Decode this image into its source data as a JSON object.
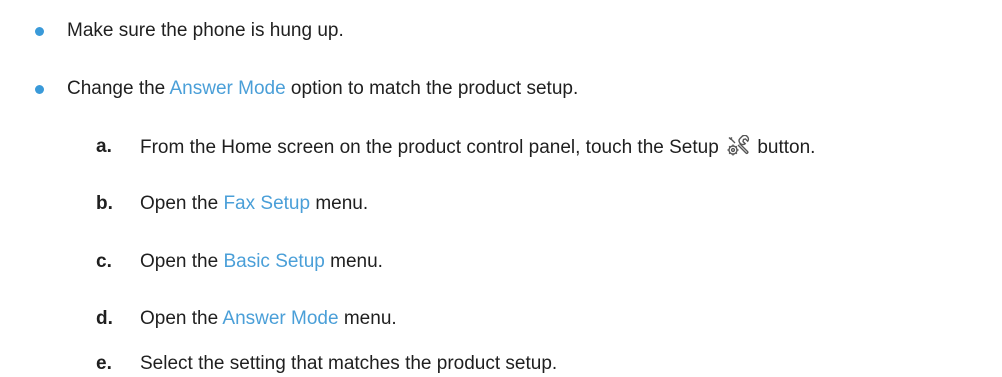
{
  "bullets": [
    {
      "text": "Make sure the phone is hung up."
    },
    {
      "pre": "Change the ",
      "kw": "Answer Mode",
      "post": " option to match the product setup."
    }
  ],
  "steps": [
    {
      "marker": "a.",
      "pre": "From the Home screen on the product control panel, touch the Setup ",
      "post": " button."
    },
    {
      "marker": "b.",
      "pre": "Open the ",
      "kw": "Fax Setup",
      "post": " menu."
    },
    {
      "marker": "c.",
      "pre": "Open the ",
      "kw": "Basic Setup",
      "post": " menu."
    },
    {
      "marker": "d.",
      "pre": "Open the ",
      "kw": "Answer Mode",
      "post": " menu."
    },
    {
      "marker": "e.",
      "text": "Select the setting that matches the product setup."
    }
  ],
  "icons": {
    "setup": "setup-wrench-gear-icon"
  },
  "colors": {
    "keyword": "#4a9fd8",
    "bullet": "#3a9ad9",
    "text": "#1f1f1f"
  }
}
